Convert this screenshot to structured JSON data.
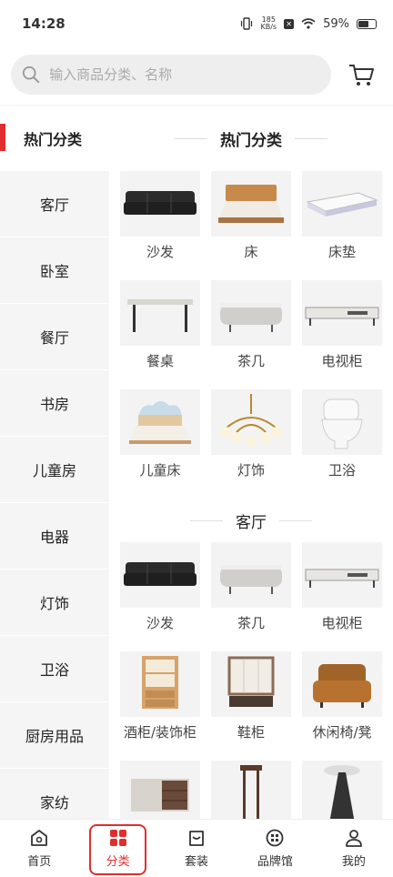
{
  "status": {
    "time": "14:28",
    "net_speed_top": "185",
    "net_speed_bottom": "KB/s",
    "battery": "59%"
  },
  "search": {
    "placeholder": "输入商品分类、名称"
  },
  "sidebar": {
    "hot_label": "热门分类",
    "items": [
      "客厅",
      "卧室",
      "餐厅",
      "书房",
      "儿童房",
      "电器",
      "灯饰",
      "卫浴",
      "厨房用品",
      "家纺"
    ]
  },
  "hot_section": {
    "title": "热门分类",
    "products": [
      "沙发",
      "床",
      "床垫",
      "餐桌",
      "茶几",
      "电视柜",
      "儿童床",
      "灯饰",
      "卫浴"
    ]
  },
  "living_section": {
    "title": "客厅",
    "products": [
      "沙发",
      "茶几",
      "电视柜",
      "酒柜/装饰柜",
      "鞋柜",
      "休闲椅/凳"
    ]
  },
  "tabbar": {
    "home": "首页",
    "category": "分类",
    "suite": "套装",
    "brand": "品牌馆",
    "mine": "我的"
  }
}
